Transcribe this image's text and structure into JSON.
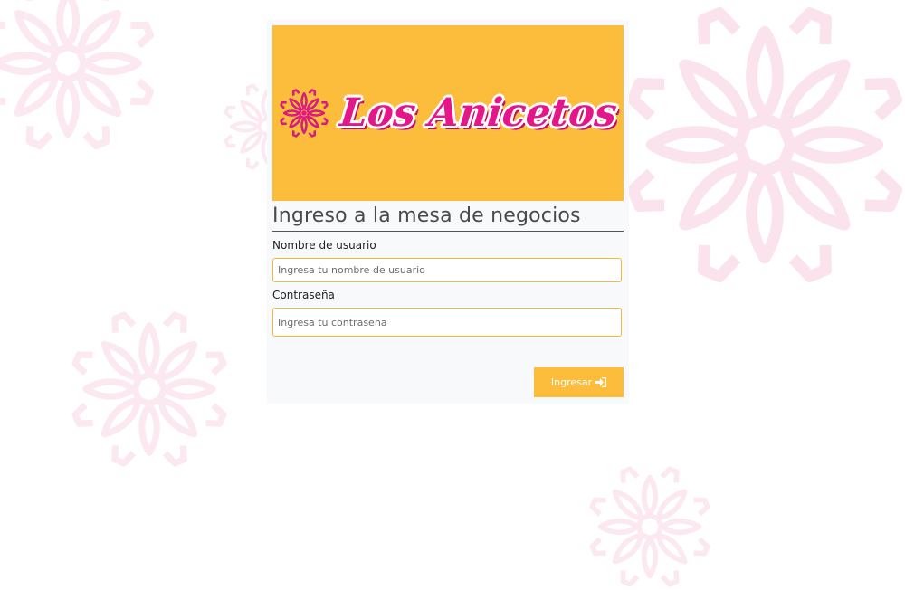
{
  "brand": {
    "name": "Los Anicetos",
    "logo_icon": "flower-icon",
    "banner_color": "#fcbc3c",
    "text_color": "#e5168a"
  },
  "form": {
    "title": "Ingreso a la mesa de negocios",
    "username_label": "Nombre de usuario",
    "username_placeholder": "Ingresa tu nombre de usuario",
    "password_label": "Contraseña",
    "password_placeholder": "Ingresa tu contraseña",
    "submit_label": "Ingresar",
    "submit_icon": "sign-in-icon"
  },
  "background": {
    "pattern_icon": "flower-icon",
    "pattern_color": "#fbe3ee"
  }
}
